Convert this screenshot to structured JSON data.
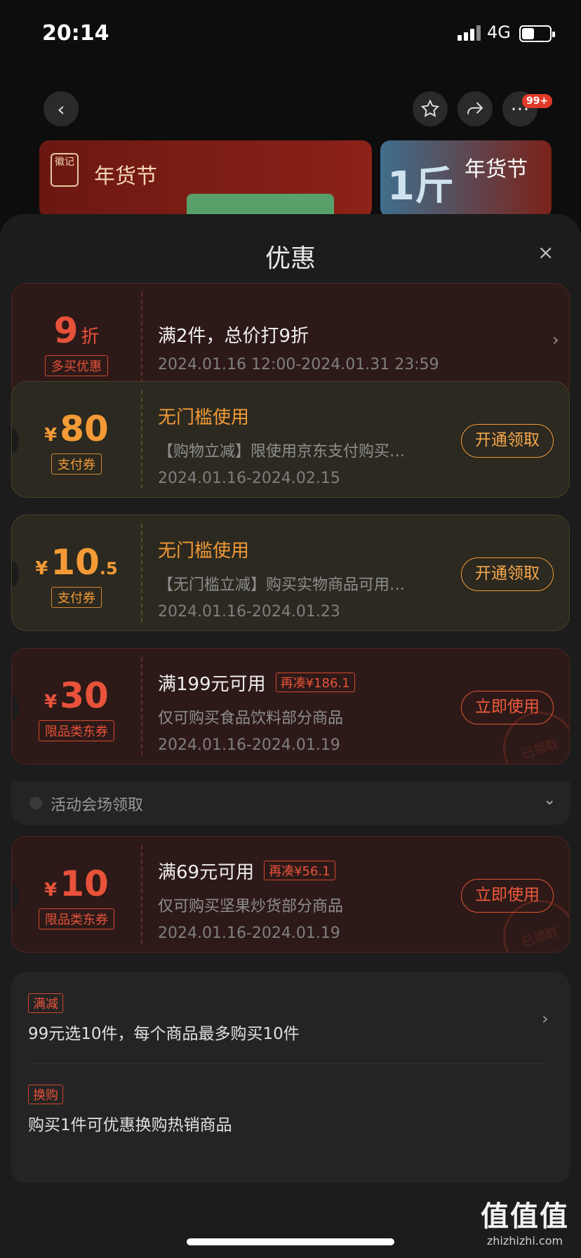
{
  "status": {
    "time": "20:14",
    "network": "4G",
    "battery_level": 0.45
  },
  "nav": {
    "badge": "99+"
  },
  "banners": [
    {
      "text": "年货节",
      "logo": "徽记"
    },
    {
      "big": "1斤",
      "text": "年货节"
    }
  ],
  "sheet": {
    "title": "优惠",
    "close": "×"
  },
  "coupons": [
    {
      "amount": "9",
      "unit": "折",
      "tag": "多买优惠",
      "title": "满2件，总价打9折",
      "date": "2024.01.16 12:00-2024.01.31 23:59",
      "chev": "›"
    },
    {
      "currency": "¥",
      "amount": "80",
      "tag": "支付券",
      "title": "无门槛使用",
      "desc": "【购物立减】限使用京东支付购买…",
      "date": "2024.01.16-2024.02.15",
      "action": "开通领取"
    },
    {
      "currency": "¥",
      "amount": "10",
      "decimal": ".5",
      "tag": "支付券",
      "title": "无门槛使用",
      "desc": "【无门槛立减】购买实物商品可用…",
      "date": "2024.01.16-2024.01.23",
      "action": "开通领取"
    },
    {
      "currency": "¥",
      "amount": "30",
      "tag": "限品类东券",
      "title": "满199元可用",
      "pill": "再凑¥186.1",
      "desc": "仅可购买食品饮料部分商品",
      "date": "2024.01.16-2024.01.19",
      "action": "立即使用",
      "stamp": "已领取"
    },
    {
      "currency": "¥",
      "amount": "10",
      "tag": "限品类东券",
      "title": "满69元可用",
      "pill": "再凑¥56.1",
      "desc": "仅可购买坚果炒货部分商品",
      "date": "2024.01.16-2024.01.19",
      "action": "立即使用",
      "stamp": "已领取"
    }
  ],
  "venue": {
    "label": "活动会场领取",
    "chev": "⌄"
  },
  "promos": [
    {
      "tag": "满减",
      "text": "99元选10件，每个商品最多购买10件",
      "chev": "›"
    },
    {
      "tag": "换购",
      "text": "购买1件可优惠换购热销商品"
    }
  ],
  "watermark": {
    "big": "值值值",
    "small": "zhizhizhi.com"
  }
}
